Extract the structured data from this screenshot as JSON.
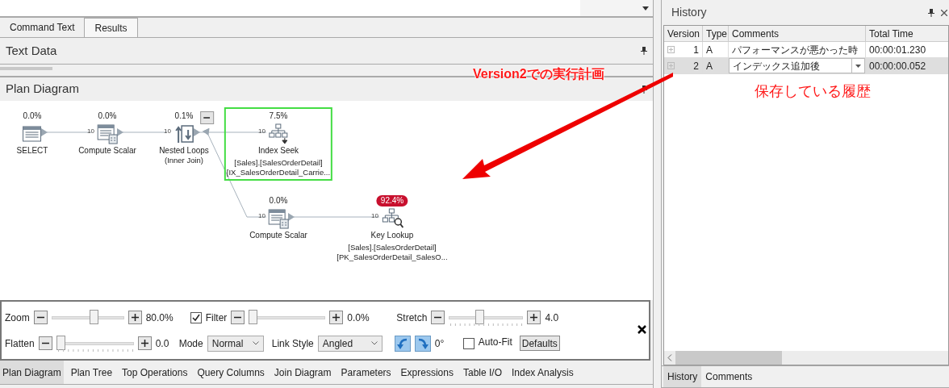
{
  "document_tabs": [
    {
      "label": "Command Text",
      "selected": false
    },
    {
      "label": "Results",
      "selected": true
    }
  ],
  "text_data": {
    "title": "Text Data"
  },
  "plan_diagram": {
    "title": "Plan Diagram",
    "nodes": [
      {
        "kind": "select",
        "cost": "0.0%",
        "label": "SELECT",
        "selected": false,
        "highlighted": false
      },
      {
        "kind": "compute",
        "cost": "0.0%",
        "label": "Compute Scalar",
        "rows": "10",
        "selected": false,
        "highlighted": false
      },
      {
        "kind": "loops",
        "cost": "0.1%",
        "label": "Nested Loops",
        "details": [
          "(Inner Join)"
        ],
        "rows": "10",
        "selected": false,
        "highlighted": false,
        "expanded": true
      },
      {
        "kind": "seek",
        "cost": "7.5%",
        "label": "Index Seek",
        "details": [
          "[Sales].[SalesOrderDetail]",
          "[IX_SalesOrderDetail_Carrie..."
        ],
        "rows": "10",
        "selected": true,
        "highlighted": false
      },
      {
        "kind": "compute",
        "cost": "0.0%",
        "label": "Compute Scalar",
        "rows": "10",
        "selected": false,
        "highlighted": false
      },
      {
        "kind": "lookup",
        "cost": "92.4%",
        "label": "Key Lookup",
        "details": [
          "[Sales].[SalesOrderDetail]",
          "[PK_SalesOrderDetail_SalesO..."
        ],
        "rows": "10",
        "selected": false,
        "highlighted": true
      }
    ]
  },
  "controls": {
    "zoom": {
      "label": "Zoom",
      "level": 0.6,
      "value": "80.0%",
      "ticks": false
    },
    "filter": {
      "label": "Filter",
      "checked": true,
      "level": 0.0,
      "value": "0.0%",
      "ticks": false
    },
    "stretch": {
      "label": "Stretch",
      "level": 0.4,
      "value": "4.0",
      "ticks": true
    },
    "flatten": {
      "label": "Flatten",
      "level": 0.0,
      "value": "0.0",
      "ticks": true
    },
    "mode": {
      "label": "Mode",
      "value": "Normal"
    },
    "link_style": {
      "label": "Link Style",
      "value": "Angled"
    },
    "rotation": "0°",
    "auto_fit": {
      "label": "Auto-Fit",
      "checked": false
    },
    "defaults_button": "Defaults"
  },
  "bottom_tabs": [
    {
      "label": "Plan Diagram",
      "selected": true
    },
    {
      "label": "Plan Tree",
      "selected": false
    },
    {
      "label": "Top Operations",
      "selected": false
    },
    {
      "label": "Query Columns",
      "selected": false
    },
    {
      "label": "Join Diagram",
      "selected": false
    },
    {
      "label": "Parameters",
      "selected": false
    },
    {
      "label": "Expressions",
      "selected": false
    },
    {
      "label": "Table I/O",
      "selected": false
    },
    {
      "label": "Index Analysis",
      "selected": false
    }
  ],
  "history": {
    "title": "History",
    "columns": [
      "Version",
      "Type",
      "Comments",
      "Total Time"
    ],
    "rows": [
      {
        "version": "1",
        "type": "A",
        "comments": "パフォーマンスが悪かった時",
        "total_time": "00:00:01.230",
        "selected": false,
        "editing": false
      },
      {
        "version": "2",
        "type": "A",
        "comments": "インデックス追加後",
        "total_time": "00:00:00.052",
        "selected": true,
        "editing": true
      }
    ],
    "tabs": [
      {
        "label": "History",
        "selected": true
      },
      {
        "label": "Comments",
        "selected": false
      }
    ]
  },
  "annotations": [
    {
      "text": "Version2での実行計画"
    },
    {
      "text": "保存している履歴"
    }
  ]
}
